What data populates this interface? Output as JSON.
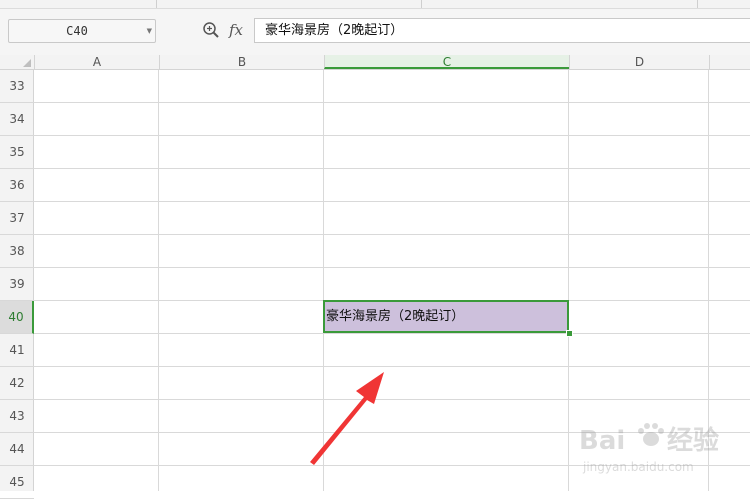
{
  "formula_bar": {
    "name_box": "C40",
    "zoom_icon": "magnifier-zoom-icon",
    "fx_label": "fx",
    "content": "豪华海景房（2晚起订）"
  },
  "columns": [
    "A",
    "B",
    "C",
    "D"
  ],
  "selected_column": "C",
  "rows": [
    "33",
    "34",
    "35",
    "36",
    "37",
    "38",
    "39",
    "40",
    "41",
    "42",
    "43",
    "44",
    "45"
  ],
  "selected_row": "40",
  "cells": {
    "C40": "豪华海景房（2晚起订）"
  },
  "selection": {
    "fill_color": "#cdc0dc",
    "border_color": "#3a9a3a"
  },
  "annotation": {
    "arrow_icon": "red-arrow-icon",
    "arrow_color": "#f03535"
  },
  "watermark": {
    "logo_text": "Baidu经验",
    "url": "jingyan.baidu.com"
  }
}
